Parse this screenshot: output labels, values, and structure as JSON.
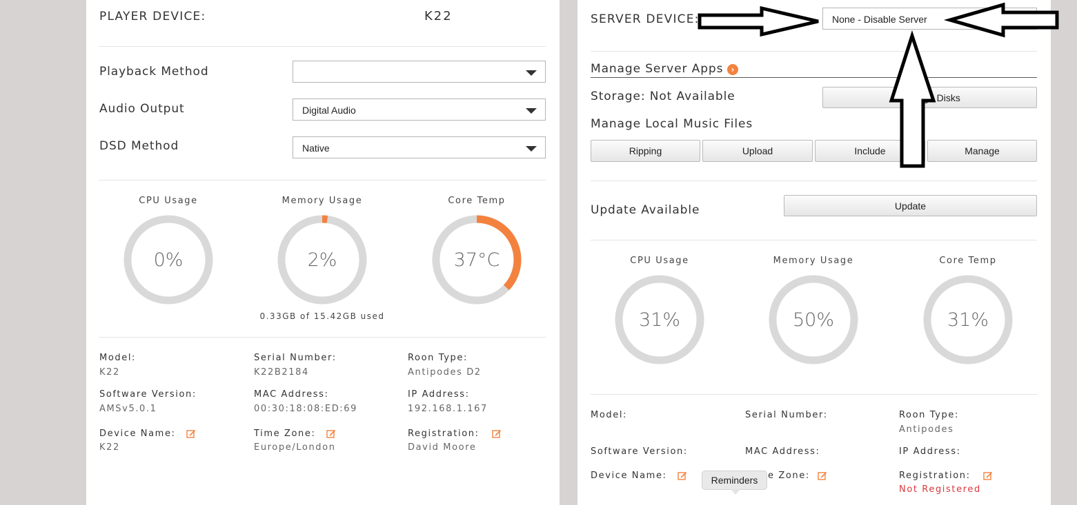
{
  "player": {
    "title": "PLAYER DEVICE:",
    "device_name": "K22",
    "settings": [
      {
        "label": "Playback Method",
        "value": ""
      },
      {
        "label": "Audio Output",
        "value": "Digital Audio"
      },
      {
        "label": "DSD Method",
        "value": "Native"
      }
    ],
    "gauges": [
      {
        "title": "CPU Usage",
        "value_text": "0%",
        "fraction": 0.0
      },
      {
        "title": "Memory Usage",
        "value_text": "2%",
        "fraction": 0.02
      },
      {
        "title": "Core Temp",
        "value_text": "37°C",
        "fraction": 0.37
      }
    ],
    "memory_note": "0.33GB of 15.42GB used",
    "info": {
      "model_label": "Model:",
      "model": "K22",
      "serial_label": "Serial Number:",
      "serial": "K22B2184",
      "roon_label": "Roon Type:",
      "roon": "Antipodes D2",
      "software_label": "Software Version:",
      "software": "AMSv5.0.1",
      "mac_label": "MAC Address:",
      "mac": "00:30:18:08:ED:69",
      "ip_label": "IP Address:",
      "ip": "192.168.1.167",
      "device_name_label": "Device Name:",
      "device_name": "K22",
      "timezone_label": "Time Zone:",
      "timezone": "Europe/London",
      "registration_label": "Registration:",
      "registration": "David Moore"
    }
  },
  "server": {
    "title": "SERVER DEVICE:",
    "select_value": "None - Disable Server",
    "manage_apps_label": "Manage Server Apps",
    "storage_label": "Storage: Not Available",
    "manage_disks_label": "Manage Disks",
    "local_music_label": "Manage Local Music Files",
    "music_buttons": [
      "Ripping",
      "Upload",
      "Include",
      "Manage"
    ],
    "update_label": "Update Available",
    "update_button": "Update",
    "gauges": [
      {
        "title": "CPU Usage",
        "value_text": "31%",
        "fraction": 0.0
      },
      {
        "title": "Memory Usage",
        "value_text": "50%",
        "fraction": 0.0
      },
      {
        "title": "Core Temp",
        "value_text": "31%",
        "fraction": 0.0
      }
    ],
    "info": {
      "model_label": "Model:",
      "serial_label": "Serial Number:",
      "roon_label": "Roon Type:",
      "roon": "Antipodes",
      "software_label": "Software Version:",
      "mac_label": "MAC Address:",
      "ip_label": "IP Address:",
      "device_name_label": "Device Name:",
      "timezone_label_partial": "e Zone:",
      "registration_label": "Registration:",
      "registration": "Not Registered"
    }
  },
  "tooltip": {
    "text": "Reminders"
  },
  "colors": {
    "accent": "#f3823f",
    "gauge_track": "#d9d9d9",
    "error": "#d9383a",
    "background": "#d6d3d2"
  },
  "icons": {
    "edit": "edit-icon",
    "chevron": "chevron-right-icon",
    "arrow": "outline-arrow"
  }
}
